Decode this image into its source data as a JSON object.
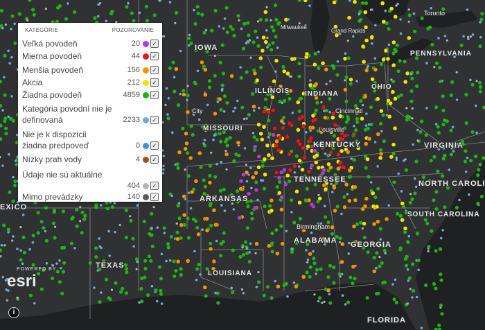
{
  "map": {
    "labels": {
      "toronto": "Toronto",
      "milwaukee": "Milwaukee",
      "grand_rapids": "Grand Rapids",
      "iowa": "IOWA",
      "illinois": "ILLINOIS",
      "indiana": "INDIANA",
      "ohio": "OHIO",
      "pennsylvania": "PENNSYLVANIA",
      "missouri": "MISSOURI",
      "kansas_city": "City",
      "cincinnati": "Cincinnati",
      "louisville": "Louisville",
      "kentucky": "KENTUCKY",
      "virginia": "VIRGINIA",
      "tennessee": "TENNESSEE",
      "north_carolina": "NORTH CAROLINA",
      "arkansas": "ARKANSAS",
      "south_carolina": "SOUTH CAROLINA",
      "mexico": "EXICO",
      "birmingham": "Birmingham",
      "alabama": "ALABAMA",
      "georgia": "GEORGIA",
      "texas": "TEXAS",
      "louisiana": "LOUISIANA",
      "florida": "FLORIDA"
    },
    "colors": {
      "background": "#2f3133",
      "water": "#1f2022",
      "borders": "#8a8a8a",
      "labels": "#e6e6e6"
    }
  },
  "legend": {
    "header_category": "KATEGÓRIE",
    "header_observation": "POZOROVANIE",
    "items": [
      {
        "label": "Veľká povodeň",
        "count": "20",
        "color": "#b73ad8"
      },
      {
        "label": "Mierna povodeň",
        "count": "44",
        "color": "#e8141c"
      },
      {
        "label": "Menšia povodeň",
        "count": "156",
        "color": "#f29600"
      },
      {
        "label": "Akcia",
        "count": "212",
        "color": "#f2e600"
      },
      {
        "label": "Žiadna povodeň",
        "count": "4859",
        "color": "#1fb414"
      },
      {
        "label": "Kategória povodní nie je definovaná",
        "count": "2233",
        "color": "#6fa8dc"
      },
      {
        "label": "Nie je k dispozícii žiadna predpoveď",
        "count": "0",
        "color": "#3d8fe0"
      },
      {
        "label": "Nízky prah vody",
        "count": "4",
        "color": "#a0521d"
      },
      {
        "label": "Údaje nie sú aktuálne",
        "count": "404",
        "color": "#b5b5b5"
      },
      {
        "label": "Mimo prevádzky",
        "count": "140",
        "color": "#5a5a5a"
      }
    ]
  },
  "branding": {
    "powered_by": "POWERED BY",
    "esri": "esri"
  },
  "controls": {
    "info_icon": "i"
  }
}
